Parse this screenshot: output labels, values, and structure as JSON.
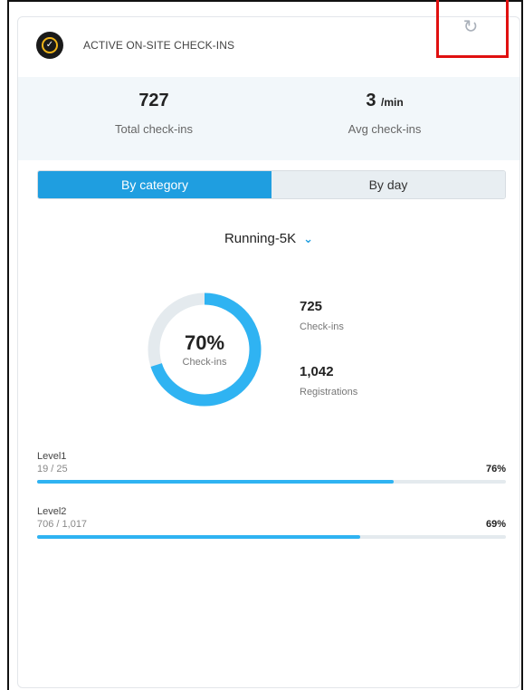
{
  "header": {
    "title": "ACTIVE ON-SITE CHECK-INS",
    "logo_icon": "check-circle-icon",
    "refresh_icon": "refresh-icon"
  },
  "stats": {
    "total": {
      "value": "727",
      "label": "Total check-ins"
    },
    "avg": {
      "value": "3",
      "unit": "/min",
      "label": "Avg check-ins"
    }
  },
  "tabs": [
    {
      "label": "By category",
      "active": true
    },
    {
      "label": "By day",
      "active": false
    }
  ],
  "category": {
    "selected": "Running-5K"
  },
  "donut": {
    "percent": "70%",
    "label": "Check-ins",
    "fraction": 0.7
  },
  "metrics": {
    "checkins": {
      "value": "725",
      "label": "Check-ins"
    },
    "registrations": {
      "value": "1,042",
      "label": "Registrations"
    }
  },
  "levels": [
    {
      "name": "Level1",
      "counts": "19 / 25",
      "percent": "76%",
      "fraction": 0.76
    },
    {
      "name": "Level2",
      "counts": "706 / 1,017",
      "percent": "69%",
      "fraction": 0.69
    }
  ],
  "colors": {
    "accent": "#1f9ee0",
    "bar": "#2fb3f2",
    "track": "#e4eaee",
    "highlight_box": "#e01010"
  }
}
